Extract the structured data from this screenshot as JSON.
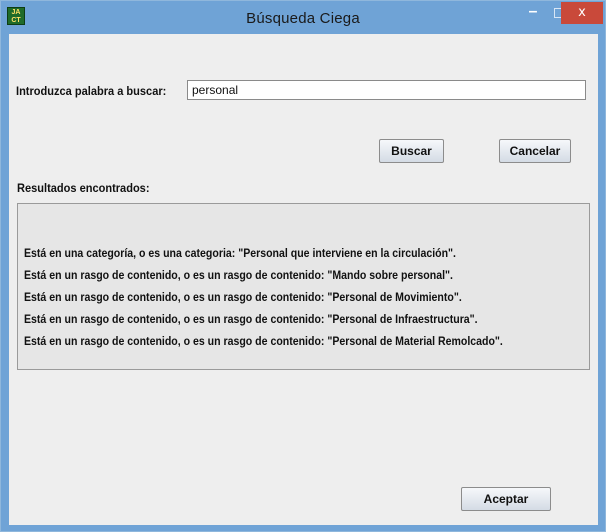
{
  "window": {
    "title": "Búsqueda Ciega",
    "icon_text": "JA\nCT",
    "minimize_glyph": "–",
    "close_glyph": "x"
  },
  "search": {
    "label": "Introduzca palabra a buscar:",
    "value": "personal"
  },
  "buttons": {
    "search": "Buscar",
    "cancel": "Cancelar",
    "accept": "Aceptar"
  },
  "results": {
    "heading": "Resultados encontrados:",
    "lines": [
      "Está en una categoría, o es una categoria: \"Personal que interviene en la circulación\".",
      "Está en un rasgo de contenido, o es un rasgo de contenido: \"Mando sobre personal\".",
      "Está en un rasgo de contenido, o es un rasgo de contenido: \"Personal de Movimiento\".",
      "Está en un rasgo de contenido, o es un rasgo de contenido: \"Personal de Infraestructura\".",
      "Está en un rasgo de contenido, o es un rasgo de contenido: \"Personal de Material Remolcado\"."
    ]
  },
  "colors": {
    "titlebar": "#6fa3d6",
    "close_button": "#c9493a",
    "panel": "#eeeeee"
  }
}
